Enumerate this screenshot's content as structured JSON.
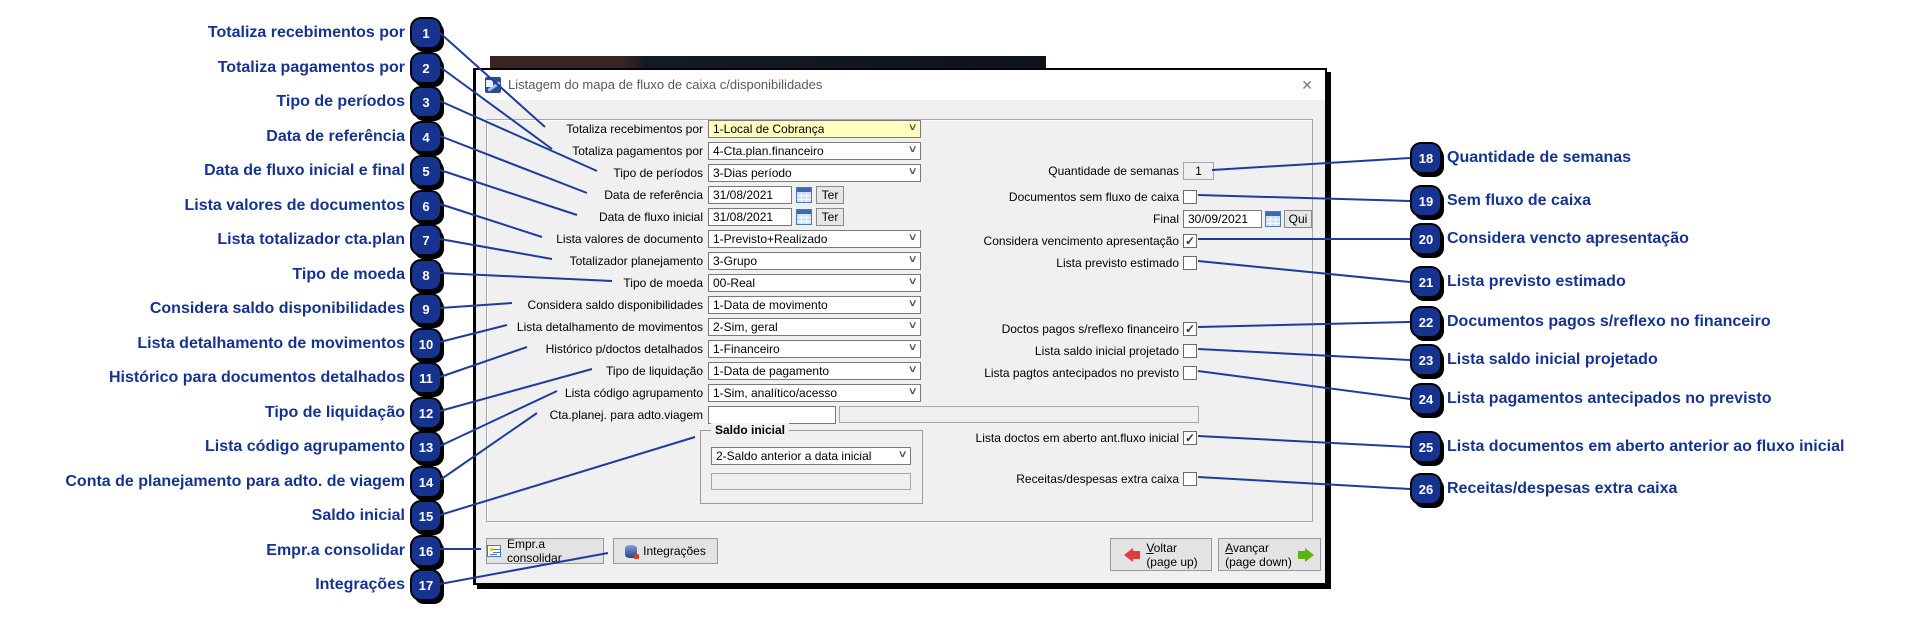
{
  "window": {
    "title": "Listagem do mapa de fluxo de caixa c/disponibilidades",
    "close_glyph": "✕"
  },
  "icons": {
    "chevron": "∨",
    "check": "✓"
  },
  "colors": {
    "callout_blue": "#16338f",
    "highlight_yellow": "#ffffbe",
    "voltar_arrow_red": "#e03c3c",
    "avancar_arrow_green": "#5cb414"
  },
  "form": {
    "rows": [
      {
        "label": "Totaliza recebimentos por",
        "value": "1-Local de Cobrança"
      },
      {
        "label": "Totaliza pagamentos por",
        "value": "4-Cta.plan.financeiro"
      },
      {
        "label": "Tipo de períodos",
        "value": "3-Dias período"
      },
      {
        "label": "Data de referência",
        "value": "31/08/2021",
        "day": "Ter"
      },
      {
        "label": "Data de fluxo inicial",
        "value": "31/08/2021",
        "day": "Ter"
      },
      {
        "label": "Lista valores de documento",
        "value": "1-Previsto+Realizado"
      },
      {
        "label": "Totalizador planejamento",
        "value": "3-Grupo"
      },
      {
        "label": "Tipo de moeda",
        "value": "00-Real"
      },
      {
        "label": "Considera saldo disponibilidades",
        "value": "1-Data de movimento"
      },
      {
        "label": "Lista detalhamento de movimentos",
        "value": "2-Sim, geral"
      },
      {
        "label": "Histórico p/doctos detalhados",
        "value": "1-Financeiro"
      },
      {
        "label": "Tipo de liquidação",
        "value": "1-Data de pagamento"
      },
      {
        "label": "Lista código agrupamento",
        "value": "1-Sim, analítico/acesso"
      },
      {
        "label": "Cta.planej. para adto.viagem",
        "value": ""
      }
    ],
    "saldo_inicial": {
      "legend": "Saldo inicial",
      "value": "2-Saldo anterior a data inicial"
    },
    "right": {
      "semanas": {
        "label": "Quantidade de semanas",
        "value": "1"
      },
      "sem_fluxo": {
        "label": "Documentos sem fluxo de caixa",
        "mark": ""
      },
      "final": {
        "label": "Final",
        "value": "30/09/2021",
        "day": "Qui"
      },
      "venc": {
        "label": "Considera vencimento apresentação",
        "mark": "✓"
      },
      "previsto": {
        "label": "Lista previsto estimado",
        "mark": ""
      },
      "doctos_pagos": {
        "label": "Doctos pagos s/reflexo financeiro",
        "mark": "✓"
      },
      "saldo_proj": {
        "label": "Lista saldo inicial projetado",
        "mark": ""
      },
      "pagtos_antec": {
        "label": "Lista pagtos antecipados no previsto",
        "mark": ""
      },
      "doctos_aberto": {
        "label": "Lista doctos em aberto ant.fluxo inicial",
        "mark": "✓"
      },
      "receitas": {
        "label": "Receitas/despesas extra caixa",
        "mark": ""
      }
    }
  },
  "buttons": {
    "empresa": "Empr.a consolidar",
    "integracoes": "Integrações",
    "voltar": "Voltar",
    "voltar_sub": "(page up)",
    "avancar": "Avançar",
    "avancar_sub": "(page down)"
  },
  "callouts_left": [
    {
      "num": "1",
      "text": "Totaliza recebimentos por"
    },
    {
      "num": "2",
      "text": "Totaliza pagamentos por"
    },
    {
      "num": "3",
      "text": "Tipo de períodos"
    },
    {
      "num": "4",
      "text": "Data de referência"
    },
    {
      "num": "5",
      "text": "Data de fluxo inicial e final"
    },
    {
      "num": "6",
      "text": "Lista valores de documentos"
    },
    {
      "num": "7",
      "text": "Lista totalizador cta.plan"
    },
    {
      "num": "8",
      "text": "Tipo de moeda"
    },
    {
      "num": "9",
      "text": "Considera saldo disponibilidades"
    },
    {
      "num": "10",
      "text": "Lista detalhamento de movimentos"
    },
    {
      "num": "11",
      "text": "Histórico para documentos detalhados"
    },
    {
      "num": "12",
      "text": "Tipo de liquidação"
    },
    {
      "num": "13",
      "text": "Lista código agrupamento"
    },
    {
      "num": "14",
      "text": "Conta de planejamento para adto. de viagem"
    },
    {
      "num": "15",
      "text": "Saldo inicial"
    },
    {
      "num": "16",
      "text": "Empr.a consolidar"
    },
    {
      "num": "17",
      "text": "Integrações"
    }
  ],
  "callouts_right": [
    {
      "num": "18",
      "text": "Quantidade de semanas"
    },
    {
      "num": "19",
      "text": "Sem fluxo de caixa"
    },
    {
      "num": "20",
      "text": "Considera vencto apresentação"
    },
    {
      "num": "21",
      "text": "Lista previsto estimado"
    },
    {
      "num": "22",
      "text": "Documentos pagos s/reflexo no financeiro"
    },
    {
      "num": "23",
      "text": "Lista saldo inicial projetado"
    },
    {
      "num": "24",
      "text": "Lista pagamentos antecipados no previsto"
    },
    {
      "num": "25",
      "text": "Lista documentos em aberto anterior ao fluxo inicial"
    },
    {
      "num": "26",
      "text": "Receitas/despesas extra caixa"
    }
  ]
}
